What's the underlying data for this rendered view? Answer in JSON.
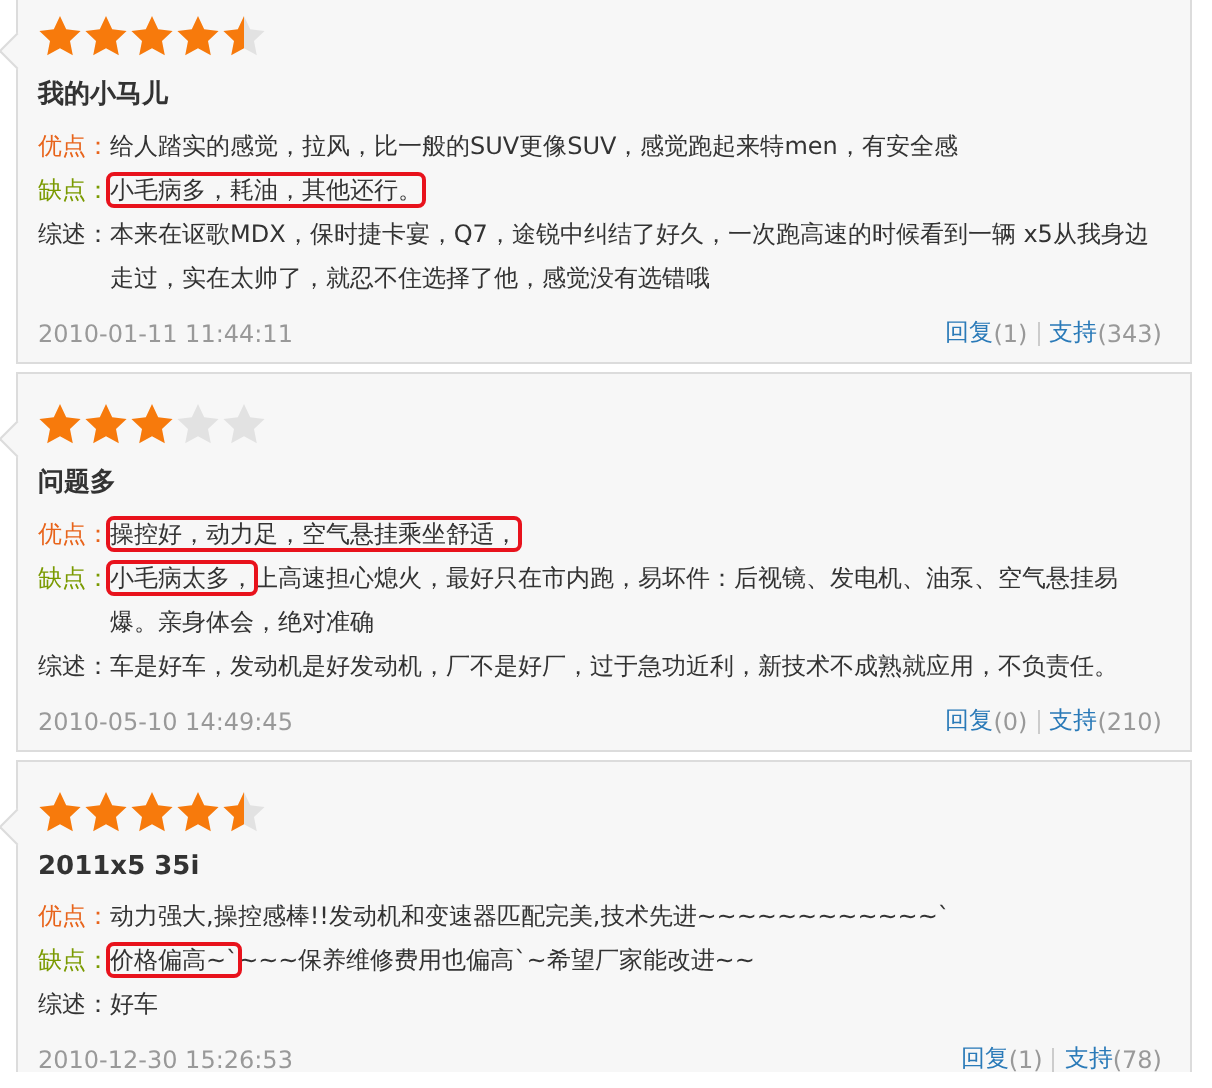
{
  "reviews": [
    {
      "stars": 4.5,
      "title": "我的小马儿",
      "pros_label": "优点：",
      "pros": [
        {
          "text": "给人踏实的感觉，拉风，比一般的SUV更像SUV，感觉跑起来特men，有安全感",
          "highlighted": false
        }
      ],
      "cons_label": "缺点：",
      "cons": [
        {
          "text": "小毛病多，耗油，其他还行。",
          "highlighted": true
        }
      ],
      "summary_label": "综述：",
      "summary": "本来在讴歌MDX，保时捷卡宴，Q7，途锐中纠结了好久，一次跑高速的时候看到一辆 x5从我身边走过，实在太帅了，就忍不住选择了他，感觉没有选错哦",
      "date": "2010-01-11 11:44:11",
      "reply_label": "回复",
      "reply_count": "(1)",
      "support_label": "支持",
      "support_count": "(343)"
    },
    {
      "stars": 3,
      "title": "问题多",
      "pros_label": "优点：",
      "pros": [
        {
          "text": "操控好，动力足，空气悬挂乘坐舒适，",
          "highlighted": true
        }
      ],
      "cons_label": "缺点：",
      "cons": [
        {
          "text": "小毛病太多，",
          "highlighted": true
        },
        {
          "text": "上高速担心熄火，最好只在市内跑，易坏件：后视镜、发电机、油泵、空气悬挂易爆。亲身体会，绝对准确",
          "highlighted": false
        }
      ],
      "summary_label": "综述：",
      "summary": "车是好车，发动机是好发动机，厂不是好厂，过于急功近利，新技术不成熟就应用，不负责任。",
      "date": "2010-05-10 14:49:45",
      "reply_label": "回复",
      "reply_count": "(0)",
      "support_label": "支持",
      "support_count": "(210)"
    },
    {
      "stars": 4.5,
      "title": "2011x5 35i",
      "pros_label": "优点：",
      "pros": [
        {
          "text": "动力强大,操控感棒!!发动机和变速器匹配完美,技术先进~~~~~~~~~~~~`",
          "highlighted": false
        }
      ],
      "cons_label": "缺点：",
      "cons": [
        {
          "text": "价格偏高~`",
          "highlighted": true
        },
        {
          "text": "~~~保养维修费用也偏高`~希望厂家能改进~~",
          "highlighted": false
        }
      ],
      "summary_label": "综述：",
      "summary": "好车",
      "date": "2010-12-30 15:26:53",
      "reply_label": "回复",
      "reply_count": "(1)",
      "support_label": "支持",
      "support_count": "(78)"
    }
  ]
}
